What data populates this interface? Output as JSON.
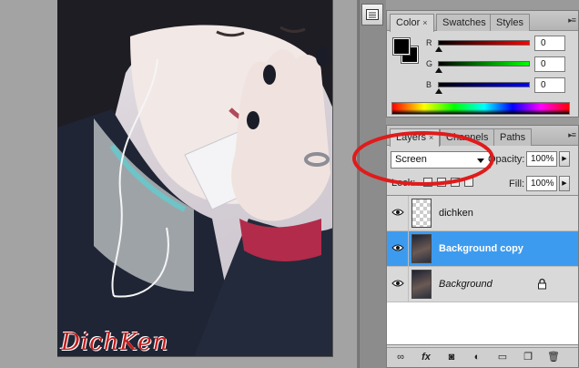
{
  "canvas": {
    "watermark": "DichKen"
  },
  "color_panel": {
    "tabs": [
      {
        "label": "Color",
        "close": "×"
      },
      {
        "label": "Swatches"
      },
      {
        "label": "Styles"
      }
    ],
    "channels": [
      {
        "label": "R",
        "value": "0",
        "color": "#d11a1a"
      },
      {
        "label": "G",
        "value": "0",
        "color": "#17c11f"
      },
      {
        "label": "B",
        "value": "0",
        "color": "#1f3fe0"
      }
    ]
  },
  "layers_panel": {
    "tabs": [
      {
        "label": "Layers",
        "close": "×"
      },
      {
        "label": "Channels"
      },
      {
        "label": "Paths"
      }
    ],
    "blend_mode": "Screen",
    "opacity_label": "Opacity:",
    "opacity_value": "100%",
    "lock_label": "Lock:",
    "fill_label": "Fill:",
    "fill_value": "100%",
    "layers": [
      {
        "name": "dichken",
        "visible": true,
        "thumbnail": "transparent",
        "selected": false
      },
      {
        "name": "Background copy",
        "visible": true,
        "thumbnail": "photo",
        "selected": true
      },
      {
        "name": "Background",
        "visible": true,
        "thumbnail": "photo",
        "selected": false,
        "locked": true
      }
    ],
    "footer_icons": [
      "link-icon",
      "fx-icon",
      "mask-icon",
      "adjustment-icon",
      "folder-icon",
      "new-layer-icon",
      "trash-icon"
    ]
  },
  "annotation_color": "#e01b1b",
  "selection_color": "#3d9bef"
}
